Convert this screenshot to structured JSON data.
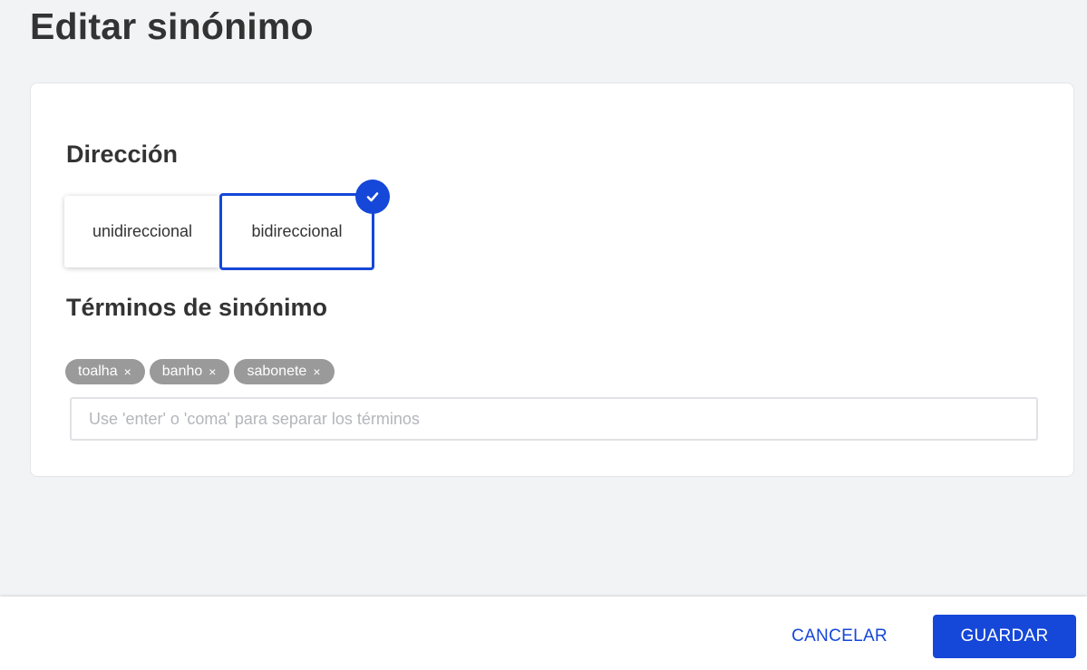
{
  "page": {
    "title": "Editar sinónimo"
  },
  "direction": {
    "title": "Dirección",
    "options": [
      {
        "label": "unidireccional",
        "selected": false
      },
      {
        "label": "bidireccional",
        "selected": true
      }
    ],
    "check_icon": "check-icon"
  },
  "terms": {
    "title": "Términos de sinónimo",
    "tags": [
      {
        "label": "toalha",
        "remove": "×"
      },
      {
        "label": "banho",
        "remove": "×"
      },
      {
        "label": "sabonete",
        "remove": "×"
      }
    ],
    "input_value": "",
    "input_placeholder": "Use 'enter' o 'coma' para separar los términos"
  },
  "footer": {
    "cancel_label": "CANCELAR",
    "save_label": "GUARDAR"
  },
  "colors": {
    "accent": "#1547d8",
    "tag_bg": "#9a9a9a",
    "page_bg": "#f2f3f5"
  }
}
